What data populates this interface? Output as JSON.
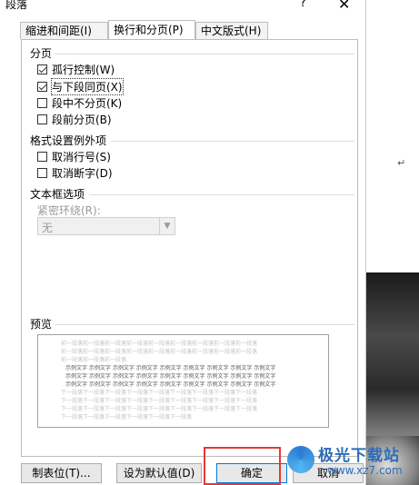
{
  "window": {
    "title": "段落",
    "help_glyph": "?",
    "close_glyph": "✕"
  },
  "tabs": [
    {
      "label": "缩进和间距(I)",
      "active": false
    },
    {
      "label": "换行和分页(P)",
      "active": true
    },
    {
      "label": "中文版式(H)",
      "active": false
    }
  ],
  "pagination": {
    "heading": "分页",
    "options": [
      {
        "label": "孤行控制(W)",
        "checked": true
      },
      {
        "label": "与下段同页(X)",
        "checked": true,
        "focused": true
      },
      {
        "label": "段中不分页(K)",
        "checked": false
      },
      {
        "label": "段前分页(B)",
        "checked": false
      }
    ]
  },
  "exceptions": {
    "heading": "格式设置例外项",
    "options": [
      {
        "label": "取消行号(S)",
        "checked": false
      },
      {
        "label": "取消断字(D)",
        "checked": false
      }
    ]
  },
  "textbox": {
    "heading": "文本框选项",
    "tight_wrap_label": "紧密环绕(R):",
    "tight_wrap_value": "无"
  },
  "preview": {
    "heading": "预览",
    "lines": [
      {
        "text": "前一段落前一段落前一段落前一段落前一段落前一段落前一段落前一段落前一段落",
        "tone": "grey"
      },
      {
        "text": "前一段落前一段落前一段落前一段落前一段落前一段落前一段落前一段落前一段落",
        "tone": "grey"
      },
      {
        "text": "前一段落前一段落前一段落",
        "tone": "grey"
      },
      {
        "text": "示例文字 示例文字 示例文字 示例文字 示例文字 示例文字 示例文字 示例文字 示例文字",
        "tone": "dark"
      },
      {
        "text": "示例文字 示例文字 示例文字 示例文字 示例文字 示例文字 示例文字 示例文字 示例文字",
        "tone": "dark"
      },
      {
        "text": "示例文字 示例文字 示例文字 示例文字 示例文字 示例文字 示例文字 示例文字 示例文字",
        "tone": "dark"
      },
      {
        "text": "下一段落下一段落下一段落下一段落下一段落下一段落下一段落下一段落下一段落",
        "tone": "grey"
      },
      {
        "text": "下一段落下一段落下一段落下一段落下一段落下一段落下一段落下一段落下一段落",
        "tone": "grey"
      },
      {
        "text": "下一段落下一段落下一段落下一段落下一段落下一段落下一段落下一段落下一段落",
        "tone": "grey"
      },
      {
        "text": "下一段落下一段落下一段落下一段落下一段落下一段落",
        "tone": "grey"
      }
    ]
  },
  "buttons": {
    "tabs_button": "制表位(T)...",
    "default_button": "设为默认值(D)",
    "ok_button": "确定",
    "cancel_button": "取消"
  },
  "document": {
    "paragraph_mark": "↵"
  },
  "watermark": {
    "brand": "极光下载站",
    "url": "www.xz7.com"
  },
  "colors": {
    "highlight": "#e53935",
    "watermark": "#2b6cb8"
  }
}
